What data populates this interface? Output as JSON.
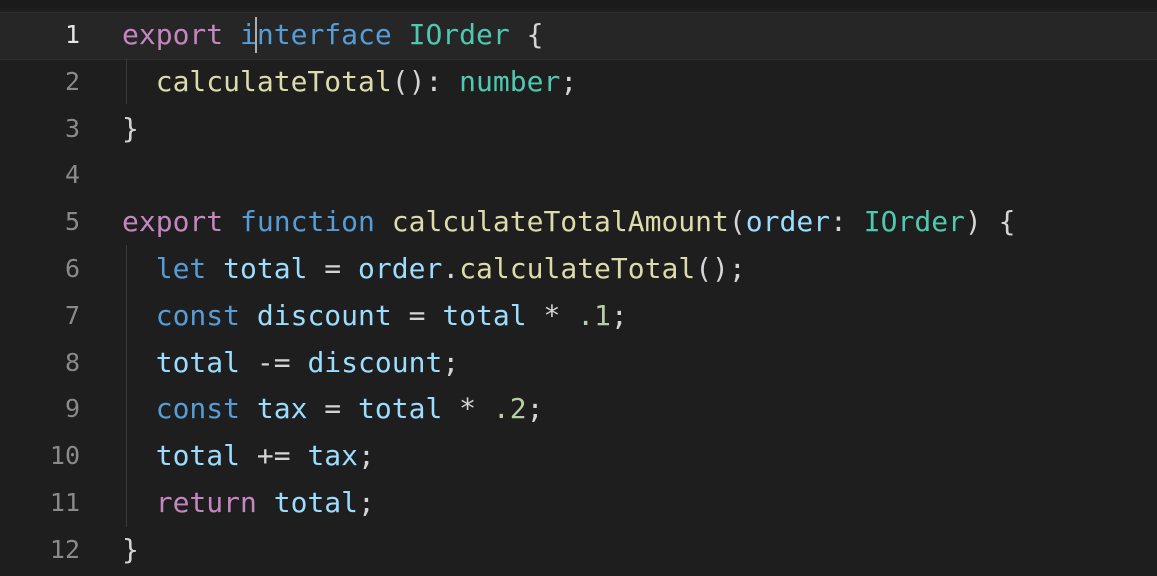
{
  "editor": {
    "lines": [
      {
        "num": "1",
        "tokens": [
          {
            "t": "export",
            "c": "kw"
          },
          {
            "t": " ",
            "c": "op"
          },
          {
            "t": "interface",
            "c": "kw2"
          },
          {
            "t": " ",
            "c": "op"
          },
          {
            "t": "IOrder",
            "c": "type"
          },
          {
            "t": " {",
            "c": "op"
          }
        ]
      },
      {
        "num": "2",
        "tokens": [
          {
            "t": "  ",
            "c": "op"
          },
          {
            "t": "calculateTotal",
            "c": "fn"
          },
          {
            "t": "(): ",
            "c": "op"
          },
          {
            "t": "number",
            "c": "type"
          },
          {
            "t": ";",
            "c": "op"
          }
        ]
      },
      {
        "num": "3",
        "tokens": [
          {
            "t": "}",
            "c": "op"
          }
        ]
      },
      {
        "num": "4",
        "tokens": []
      },
      {
        "num": "5",
        "tokens": [
          {
            "t": "export",
            "c": "kw"
          },
          {
            "t": " ",
            "c": "op"
          },
          {
            "t": "function",
            "c": "kw2"
          },
          {
            "t": " ",
            "c": "op"
          },
          {
            "t": "calculateTotalAmount",
            "c": "fn"
          },
          {
            "t": "(",
            "c": "op"
          },
          {
            "t": "order",
            "c": "var"
          },
          {
            "t": ": ",
            "c": "op"
          },
          {
            "t": "IOrder",
            "c": "type"
          },
          {
            "t": ") {",
            "c": "op"
          }
        ]
      },
      {
        "num": "6",
        "tokens": [
          {
            "t": "  ",
            "c": "op"
          },
          {
            "t": "let",
            "c": "kw2"
          },
          {
            "t": " ",
            "c": "op"
          },
          {
            "t": "total",
            "c": "var"
          },
          {
            "t": " = ",
            "c": "op"
          },
          {
            "t": "order",
            "c": "var"
          },
          {
            "t": ".",
            "c": "op"
          },
          {
            "t": "calculateTotal",
            "c": "fn"
          },
          {
            "t": "();",
            "c": "op"
          }
        ]
      },
      {
        "num": "7",
        "tokens": [
          {
            "t": "  ",
            "c": "op"
          },
          {
            "t": "const",
            "c": "kw2"
          },
          {
            "t": " ",
            "c": "op"
          },
          {
            "t": "discount",
            "c": "var"
          },
          {
            "t": " = ",
            "c": "op"
          },
          {
            "t": "total",
            "c": "var"
          },
          {
            "t": " * ",
            "c": "op"
          },
          {
            "t": ".1",
            "c": "num"
          },
          {
            "t": ";",
            "c": "op"
          }
        ]
      },
      {
        "num": "8",
        "tokens": [
          {
            "t": "  ",
            "c": "op"
          },
          {
            "t": "total",
            "c": "var"
          },
          {
            "t": " -= ",
            "c": "op"
          },
          {
            "t": "discount",
            "c": "var"
          },
          {
            "t": ";",
            "c": "op"
          }
        ]
      },
      {
        "num": "9",
        "tokens": [
          {
            "t": "  ",
            "c": "op"
          },
          {
            "t": "const",
            "c": "kw2"
          },
          {
            "t": " ",
            "c": "op"
          },
          {
            "t": "tax",
            "c": "var"
          },
          {
            "t": " = ",
            "c": "op"
          },
          {
            "t": "total",
            "c": "var"
          },
          {
            "t": " * ",
            "c": "op"
          },
          {
            "t": ".2",
            "c": "num"
          },
          {
            "t": ";",
            "c": "op"
          }
        ]
      },
      {
        "num": "10",
        "tokens": [
          {
            "t": "  ",
            "c": "op"
          },
          {
            "t": "total",
            "c": "var"
          },
          {
            "t": " += ",
            "c": "op"
          },
          {
            "t": "tax",
            "c": "var"
          },
          {
            "t": ";",
            "c": "op"
          }
        ]
      },
      {
        "num": "11",
        "tokens": [
          {
            "t": "  ",
            "c": "op"
          },
          {
            "t": "return",
            "c": "kw"
          },
          {
            "t": " ",
            "c": "op"
          },
          {
            "t": "total",
            "c": "var"
          },
          {
            "t": ";",
            "c": "op"
          }
        ]
      },
      {
        "num": "12",
        "tokens": [
          {
            "t": "}",
            "c": "op"
          }
        ]
      }
    ],
    "colors": {
      "background": "#1e1e1e",
      "keyword_control": "#c586c0",
      "keyword_decl": "#569cd6",
      "type": "#4ec9b0",
      "function": "#dcdcaa",
      "variable": "#9cdcfe",
      "number": "#b5cea8",
      "punctuation": "#d4d4d4",
      "line_number": "#8a8a8a"
    }
  }
}
